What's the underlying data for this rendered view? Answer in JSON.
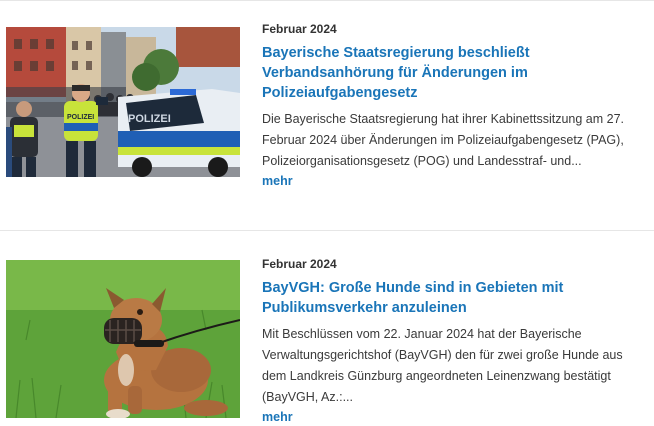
{
  "articles": [
    {
      "date": "Februar 2024",
      "title": "Bayerische Staatsregierung beschließt Verbandsanhörung für Änderungen im Polizeiaufgabengesetz",
      "teaser": "Die Bayerische Staatsregierung hat ihrer Kabinettssitzung am 27. Februar 2024 über Änderungen im Polizeiaufgabengesetz (PAG), Polizeiorganisationsgesetz (POG) und Landesstraf- und...",
      "more_label": "mehr",
      "image_icon": "police-photo",
      "van_label": "POLIZEI",
      "vest_label": "POLIZEI"
    },
    {
      "date": "Februar 2024",
      "title": "BayVGH: Große Hunde sind in Gebieten mit Publikumsverkehr anzuleinen",
      "teaser": "Mit Beschlüssen vom 22. Januar 2024 hat der Bayerische Verwaltungsgerichtshof (BayVGH) den für zwei große Hunde aus dem Landkreis Günzburg angeordneten Leinenzwang bestätigt (BayVGH, Az.:...",
      "more_label": "mehr",
      "image_icon": "dog-photo"
    }
  ],
  "colors": {
    "link": "#1a75b8",
    "text": "#3a3a3a",
    "divider": "#e6e6e6"
  }
}
